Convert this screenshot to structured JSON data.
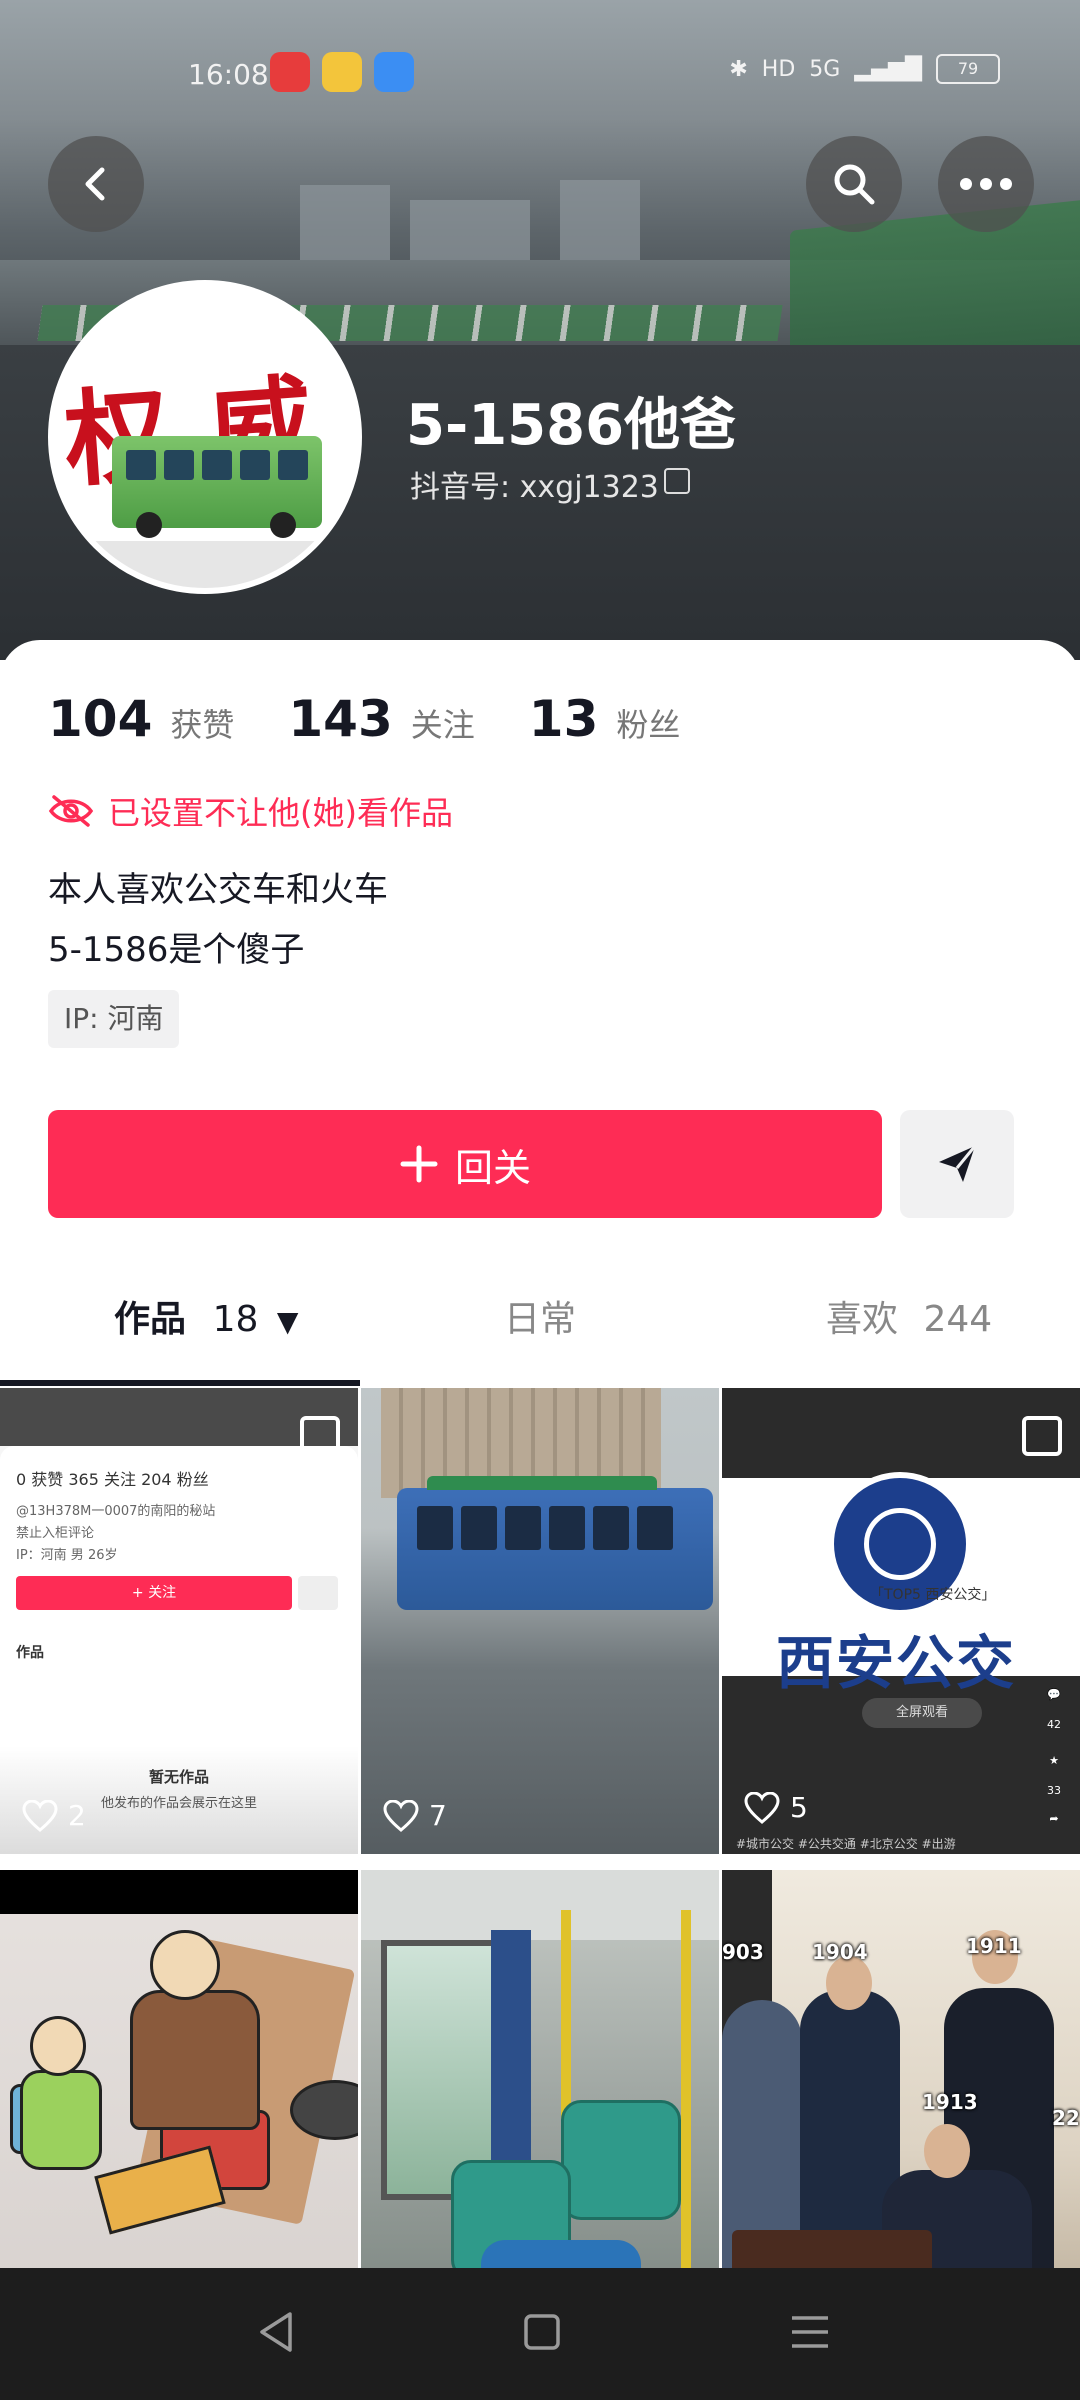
{
  "status_bar": {
    "time": "16:08",
    "network": "5G",
    "hd": "HD",
    "battery": "79"
  },
  "header": {
    "back_icon": "chevron-left-icon",
    "search_icon": "search-icon",
    "more_icon": "more-horizontal-icon"
  },
  "profile": {
    "nickname": "5-1586他爸",
    "douyin_id_label": "抖音号:",
    "douyin_id": "xxgj1323",
    "avatar_text": "权威"
  },
  "stats": [
    {
      "value": "104",
      "label": "获赞"
    },
    {
      "value": "143",
      "label": "关注"
    },
    {
      "value": "13",
      "label": "粉丝"
    }
  ],
  "privacy_notice": "已设置不让他(她)看作品",
  "bio": [
    "本人喜欢公交车和火车",
    "5-1586是个傻子"
  ],
  "ip_tag": "IP:  河南",
  "actions": {
    "follow_back_label": "回关",
    "message_icon": "send-icon"
  },
  "tabs": [
    {
      "label": "作品",
      "count": "18"
    },
    {
      "label": "日常",
      "count": ""
    },
    {
      "label": "喜欢",
      "count": "244"
    }
  ],
  "posts": [
    {
      "likes": "2",
      "mini_profile": {
        "stats": "0 获赞   365 关注   204 粉丝",
        "line1": "@13H378M一0007的南阳的秘站",
        "line2": "禁止入柜评论",
        "line3": "IP：河南   男 26岁",
        "follow_label": "+ 关注",
        "tab": "作品",
        "empty_title": "暂无作品",
        "empty_sub": "他发布的作品会展示在这里"
      }
    },
    {
      "likes": "7"
    },
    {
      "likes": "5",
      "logo_text": "西安公交",
      "top5_text": "「TOP5 西安公交」",
      "landscape_text": "全屏观看",
      "side_counts": [
        "42",
        "33"
      ],
      "caption": "#城市公交 #公共交通 #北京公交 #出游"
    },
    {
      "likes": ""
    },
    {
      "likes": ""
    },
    {
      "likes": "",
      "labels": [
        "903",
        "1904",
        "1911",
        "1913",
        "22"
      ]
    }
  ],
  "colors": {
    "accent": "#fe2c55",
    "text_primary": "#161823",
    "text_secondary": "#777777",
    "tag_bg": "#f1f1f2"
  }
}
